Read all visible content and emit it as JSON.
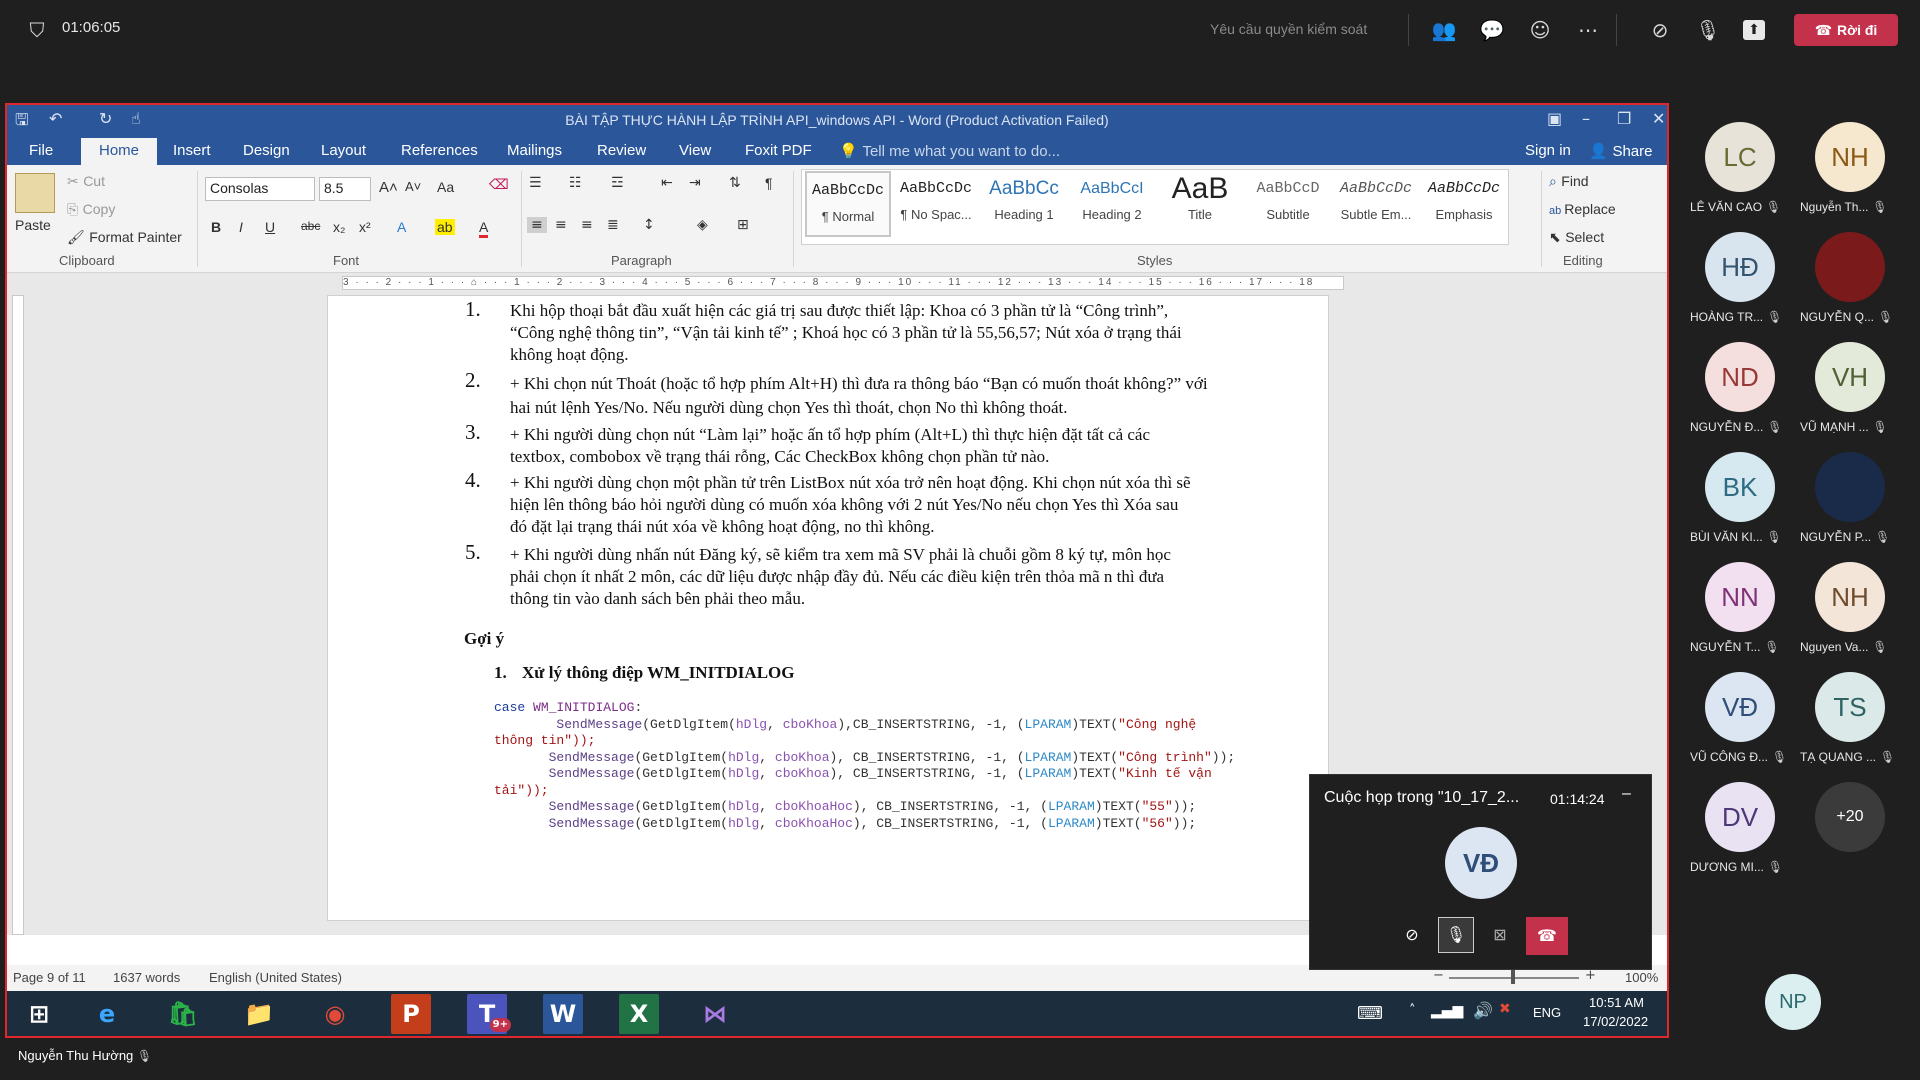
{
  "topbar": {
    "timer": "01:06:05",
    "request_control": "Yêu cầu quyền kiểm soát",
    "leave_label": "Rời đi"
  },
  "word": {
    "title": "BÀI TẬP THỰC HÀNH LẬP TRÌNH API_windows API - Word (Product Activation Failed)",
    "tabs": [
      "File",
      "Home",
      "Insert",
      "Design",
      "Layout",
      "References",
      "Mailings",
      "Review",
      "View",
      "Foxit PDF"
    ],
    "tell_me": "Tell me what you want to do...",
    "sign_in": "Sign in",
    "share": "Share",
    "clipboard": {
      "paste": "Paste",
      "cut": "Cut",
      "copy": "Copy",
      "format_painter": "Format Painter",
      "group": "Clipboard"
    },
    "font": {
      "family": "Consolas",
      "size": "8.5",
      "group": "Font",
      "case": "Aa"
    },
    "paragraph_group": "Paragraph",
    "styles": [
      {
        "preview": "AaBbCcDc",
        "name": "¶ Normal"
      },
      {
        "preview": "AaBbCcDc",
        "name": "¶ No Spac..."
      },
      {
        "preview": "AaBbCc",
        "name": "Heading 1"
      },
      {
        "preview": "AaBbCcI",
        "name": "Heading 2"
      },
      {
        "preview": "AaB",
        "name": "Title"
      },
      {
        "preview": "AaBbCcD",
        "name": "Subtitle"
      },
      {
        "preview": "AaBbCcDc",
        "name": "Subtle Em..."
      },
      {
        "preview": "AaBbCcDc",
        "name": "Emphasis"
      }
    ],
    "styles_group": "Styles",
    "editing": {
      "find": "Find",
      "replace": "Replace",
      "select": "Select",
      "group": "Editing"
    },
    "ruler_text": "3 · · · 2 · · · 1 · · · ⌂ · · · 1 · · · 2 · · · 3 · · · 4 · · · 5 · · · 6 · · · 7 · · · 8 · · · 9 · · · 10 · · · 11 · · · 12 · · · 13 · · · 14 · · · 15 · · · 16 · · · 17 · · · 18",
    "document": {
      "items": [
        {
          "num": "1.",
          "lines": [
            "Khi hộp thoại bắt đầu xuất hiện các giá trị sau được thiết lập:  Khoa có 3 phần tử là “Công trình”,",
            "“Công nghệ thông tin”, “Vận tải kinh tế” ; Khoá học có 3 phần tử là 55,56,57; Nút xóa ở trạng thái",
            "không hoạt động."
          ]
        },
        {
          "num": "2.",
          "lines": [
            "+ Khi chọn nút Thoát (hoặc tổ hợp phím Alt+H) thì đưa ra thông báo “Bạn có muốn thoát không?” với",
            "hai nút lệnh Yes/No. Nếu người dùng chọn Yes thì thoát, chọn No thì không thoát."
          ]
        },
        {
          "num": "3.",
          "lines": [
            "+ Khi người dùng chọn nút “Làm lại” hoặc ấn tổ hợp phím (Alt+L) thì thực hiện đặt tất cả các",
            "textbox, combobox về trạng thái rỗng, Các CheckBox không chọn phần tử nào."
          ]
        },
        {
          "num": "4.",
          "lines": [
            "+ Khi người dùng chọn một phần tử trên ListBox nút xóa trở nên hoạt động. Khi chọn nút xóa thì sẽ",
            "hiện lên thông báo hỏi người dùng có muốn xóa không với 2 nút Yes/No nếu chọn Yes thì Xóa sau",
            "đó đặt lại trạng thái nút xóa về không hoạt động, no thì không."
          ]
        },
        {
          "num": "5.",
          "lines": [
            "+ Khi người dùng nhấn nút Đăng ký, sẽ kiểm tra xem mã SV phải là chuỗi gồm 8 ký tự, môn học",
            "phải chọn ít nhất 2 môn, các dữ liệu được nhập đầy đủ. Nếu các điều kiện trên thỏa mã n thì đưa",
            "thông tin vào danh sách bên phải theo mẫu."
          ]
        }
      ],
      "hint_heading": "Gợi ý",
      "sub_heading_num": "1.",
      "sub_heading": "Xử lý thông điệp WM_INITDIALOG",
      "code": {
        "case_kw": "case",
        "case_label": "WM_INITDIALOG",
        "case_colon": ":",
        "calls": [
          {
            "fn": "SendMessage",
            "a": "(GetDlgItem(",
            "h": "hDlg",
            "c": "cboKhoa",
            "m": "),CB_INSERTSTRING, -1, (",
            "p": "LPARAM",
            "t": ")TEXT(",
            "s": "\"Công nghệ",
            "tail": ""
          },
          {
            "fn": "SendMessage",
            "a": "(GetDlgItem(",
            "h": "hDlg",
            "c": "cboKhoa",
            "m": "), CB_INSERTSTRING, -1, (",
            "p": "LPARAM",
            "t": ")TEXT(",
            "s": "\"Công trình\"",
            "tail": "));"
          },
          {
            "fn": "SendMessage",
            "a": "(GetDlgItem(",
            "h": "hDlg",
            "c": "cboKhoa",
            "m": "), CB_INSERTSTRING, -1, (",
            "p": "LPARAM",
            "t": ")TEXT(",
            "s": "\"Kinh tế vận",
            "tail": ""
          },
          {
            "fn": "SendMessage",
            "a": "(GetDlgItem(",
            "h": "hDlg",
            "c": "cboKhoaHoc",
            "m": "), CB_INSERTSTRING, -1, (",
            "p": "LPARAM",
            "t": ")TEXT(",
            "s": "\"55\"",
            "tail": "));"
          },
          {
            "fn": "SendMessage",
            "a": "(GetDlgItem(",
            "h": "hDlg",
            "c": "cboKhoaHoc",
            "m": "), CB_INSERTSTRING, -1, (",
            "p": "LPARAM",
            "t": ")TEXT(",
            "s": "\"56\"",
            "tail": "));"
          }
        ],
        "wrap1": "thông tin\"));",
        "wrap2": "tải\"));"
      }
    },
    "status": {
      "page": "Page 9 of 11",
      "words": "1637 words",
      "language": "English (United States)",
      "zoom": "100%"
    }
  },
  "taskbar": {
    "time": "10:51 AM",
    "date": "17/02/2022",
    "lang": "ENG",
    "teams_badge": "9+"
  },
  "floating_call": {
    "title": "Cuộc họp trong \"10_17_2...",
    "timer": "01:14:24",
    "avatar": "VĐ"
  },
  "presenter": "Nguyễn Thu Hường",
  "participants": [
    {
      "initials": "LC",
      "name": "LÊ VĂN CAO",
      "bg": "#e7e3d9",
      "fg": "#6b6a33"
    },
    {
      "initials": "NH",
      "name": "Nguyễn Th...",
      "bg": "#f6e7cf",
      "fg": "#8a5a16"
    },
    {
      "initials": "HĐ",
      "name": "HOÀNG TR...",
      "bg": "#d8e4ee",
      "fg": "#325470"
    },
    {
      "initials": "",
      "name": "NGUYỄN Q...",
      "bg": "#7a1a1a",
      "fg": "#ffffff"
    },
    {
      "initials": "ND",
      "name": "NGUYỄN Đ...",
      "bg": "#f4dede",
      "fg": "#993838"
    },
    {
      "initials": "VH",
      "name": "VŨ MẠNH ...",
      "bg": "#e4ead9",
      "fg": "#4f6033"
    },
    {
      "initials": "BK",
      "name": "BÙI VĂN KI...",
      "bg": "#d6e9f0",
      "fg": "#2d6b82"
    },
    {
      "initials": "",
      "name": "NGUYỄN P...",
      "bg": "#1a2b4a",
      "fg": "#ffffff"
    },
    {
      "initials": "NN",
      "name": "NGUYỄN T...",
      "bg": "#f2dff0",
      "fg": "#7f3276"
    },
    {
      "initials": "NH",
      "name": "Nguyen Va...",
      "bg": "#f3e6d8",
      "fg": "#6e4b2c"
    },
    {
      "initials": "VĐ",
      "name": "VŨ CÔNG Đ...",
      "bg": "#dce6f2",
      "fg": "#2f4f7a"
    },
    {
      "initials": "TS",
      "name": "TẠ QUANG ...",
      "bg": "#dbe9e9",
      "fg": "#2f6363"
    },
    {
      "initials": "DV",
      "name": "DƯƠNG MI...",
      "bg": "#e9e2f3",
      "fg": "#4e3878"
    },
    {
      "initials": "+20",
      "name": "",
      "bg": "#3b3b3b",
      "fg": "#ffffff"
    }
  ],
  "self_avatar": "NP"
}
